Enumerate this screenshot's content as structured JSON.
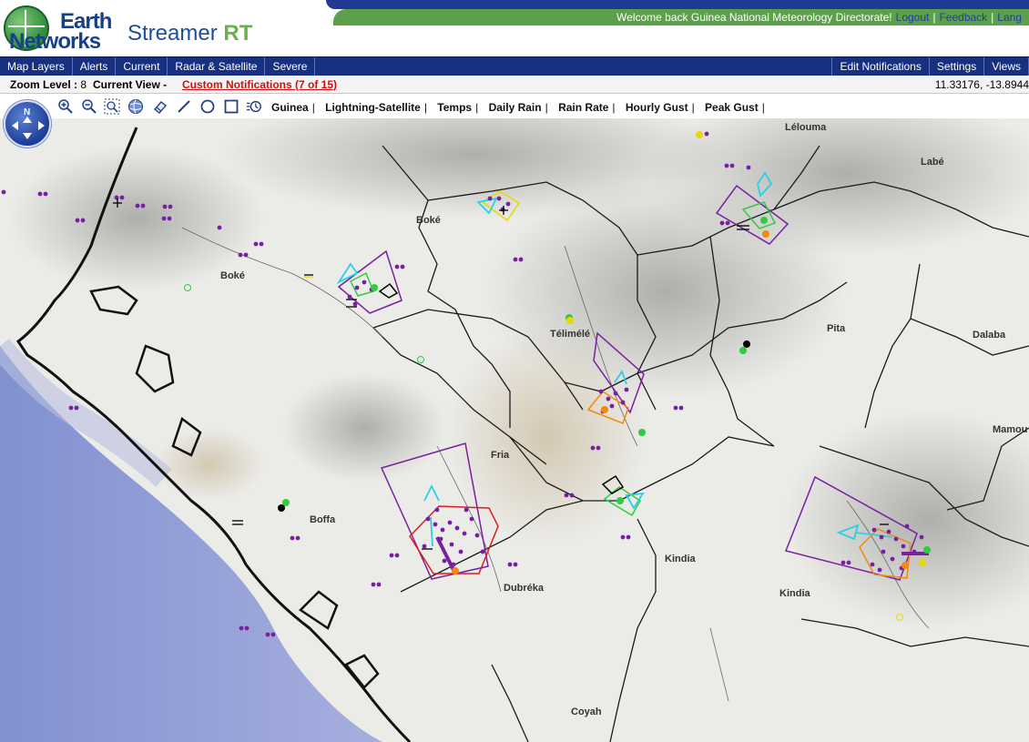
{
  "header": {
    "logo_line1": "Earth",
    "logo_line2": "Networks",
    "product_name": "Streamer",
    "product_suffix": "RT",
    "welcome_text": "Welcome back  Guinea National Meteorology Directorate!",
    "logout": "Logout",
    "feedback": "Feedback",
    "language": "Lang"
  },
  "nav": {
    "left": [
      "Map Layers",
      "Alerts",
      "Current",
      "Radar & Satellite",
      "Severe"
    ],
    "right": [
      "Edit Notifications",
      "Settings",
      "Views"
    ]
  },
  "info": {
    "zoom_label": "Zoom Level : ",
    "zoom_value": "8",
    "current_view": "Current View -",
    "custom_notifications": "Custom Notifications (7 of 15)",
    "coordinates": "11.33176, -13.8944"
  },
  "toolbar": {
    "tools": [
      "zoom-in-icon",
      "zoom-out-icon",
      "zoom-box-icon",
      "globe-icon",
      "eraser-icon",
      "line-draw-icon",
      "circle-draw-icon",
      "rectangle-draw-icon",
      "history-icon"
    ],
    "presets": [
      "Guinea",
      "Lightning-Satellite",
      "Temps",
      "Daily Rain",
      "Rain Rate",
      "Hourly Gust",
      "Peak Gust"
    ]
  },
  "navigator": {
    "north_label": "N"
  },
  "map": {
    "places": [
      {
        "name": "Lélouma"
      },
      {
        "name": "Labé"
      },
      {
        "name": "Boké"
      },
      {
        "name": "Boké"
      },
      {
        "name": "Télimélé"
      },
      {
        "name": "Pita"
      },
      {
        "name": "Dalaba"
      },
      {
        "name": "Fria"
      },
      {
        "name": "Mamou"
      },
      {
        "name": "Boffa"
      },
      {
        "name": "Kindia"
      },
      {
        "name": "Kindia"
      },
      {
        "name": "Dubréka"
      },
      {
        "name": "Coyah"
      }
    ],
    "colors": {
      "ocean": "#8a9ad6",
      "land": "#ececea",
      "relief": "#a8a8a4",
      "alert_polygon": "#7a1fa2",
      "storm_track": "#2ad0e8"
    }
  }
}
